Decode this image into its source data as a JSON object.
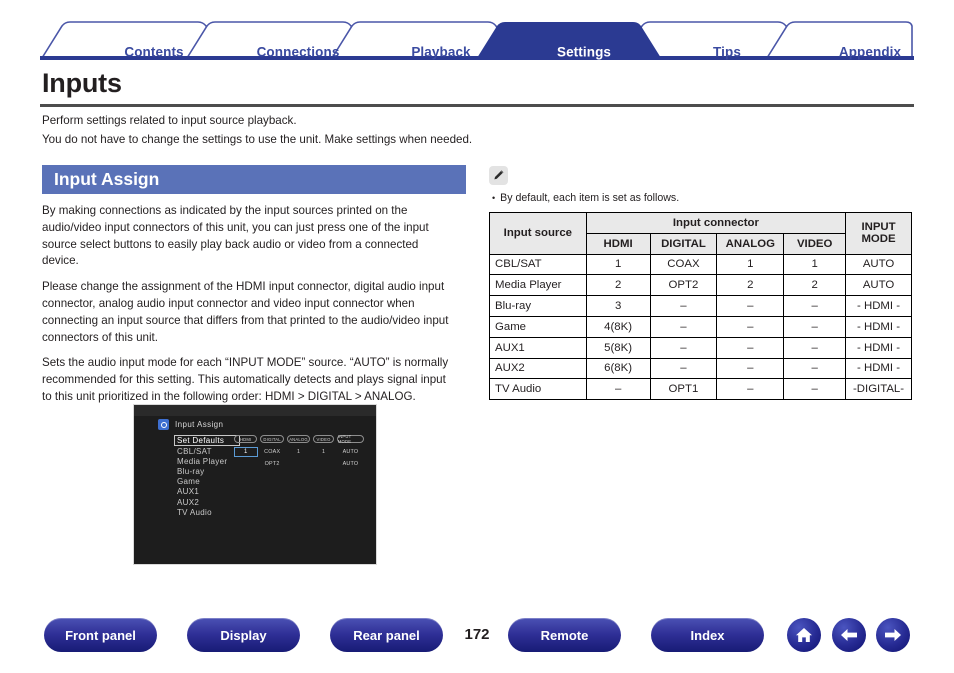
{
  "tabs": [
    {
      "label": "Contents",
      "active": false
    },
    {
      "label": "Connections",
      "active": false
    },
    {
      "label": "Playback",
      "active": false
    },
    {
      "label": "Settings",
      "active": true
    },
    {
      "label": "Tips",
      "active": false
    },
    {
      "label": "Appendix",
      "active": false
    }
  ],
  "page": {
    "title": "Inputs",
    "intro_line1": "Perform settings related to input source playback.",
    "intro_line2": "You do not have to change the settings to use the unit. Make settings when needed."
  },
  "section": {
    "header": "Input Assign",
    "paragraphs": [
      "By making connections as indicated by the input sources printed on the audio/video input connectors of this unit, you can just press one of the input source select buttons to easily play back audio or video from a connected device.",
      "Please change the assignment of the HDMI input connector, digital audio input connector, analog audio input connector and video input connector when connecting an input source that differs from that printed to the audio/video input connectors of this unit.",
      "Sets the audio input mode for each “INPUT MODE” source. “AUTO” is normally recommended for this setting. This automatically detects and plays signal input to this unit prioritized in the following order: HDMI > DIGITAL > ANALOG."
    ]
  },
  "osd": {
    "title": "Input Assign",
    "menu_items": [
      "Set Defaults",
      "CBL/SAT",
      "Media Player",
      "Blu-ray",
      "Game",
      "AUX1",
      "AUX2",
      "TV Audio"
    ],
    "selected_index": 0,
    "column_labels": [
      "HDMI",
      "DIGITAL",
      "ANALOG",
      "VIDEO",
      "INPUT MODE"
    ],
    "value_rows": [
      [
        "1",
        "COAX",
        "1",
        "1",
        "AUTO"
      ],
      [
        "",
        "OPT2",
        "",
        "",
        "AUTO"
      ]
    ]
  },
  "note": {
    "bullet": "•",
    "text": "By default, each item is set as follows."
  },
  "table": {
    "header_source": "Input source",
    "header_group": "Input connector",
    "header_mode_line1": "INPUT",
    "header_mode_line2": "MODE",
    "subheaders": [
      "HDMI",
      "DIGITAL",
      "ANALOG",
      "VIDEO"
    ],
    "rows": [
      {
        "source": "CBL/SAT",
        "hdmi": "1",
        "digital": "COAX",
        "analog": "1",
        "video": "1",
        "mode": "AUTO"
      },
      {
        "source": "Media Player",
        "hdmi": "2",
        "digital": "OPT2",
        "analog": "2",
        "video": "2",
        "mode": "AUTO"
      },
      {
        "source": "Blu-ray",
        "hdmi": "3",
        "digital": "–",
        "analog": "–",
        "video": "–",
        "mode": "- HDMI -"
      },
      {
        "source": "Game",
        "hdmi": "4(8K)",
        "digital": "–",
        "analog": "–",
        "video": "–",
        "mode": "- HDMI -"
      },
      {
        "source": "AUX1",
        "hdmi": "5(8K)",
        "digital": "–",
        "analog": "–",
        "video": "–",
        "mode": "- HDMI -"
      },
      {
        "source": "AUX2",
        "hdmi": "6(8K)",
        "digital": "–",
        "analog": "–",
        "video": "–",
        "mode": "- HDMI -"
      },
      {
        "source": "TV Audio",
        "hdmi": "–",
        "digital": "OPT1",
        "analog": "–",
        "video": "–",
        "mode": "-DIGITAL-"
      }
    ]
  },
  "footer": {
    "buttons": [
      "Front panel",
      "Display",
      "Rear panel",
      "Remote",
      "Index"
    ],
    "page_number": "172",
    "nav_icons": [
      "home-icon",
      "arrow-left-icon",
      "arrow-right-icon"
    ]
  },
  "colors": {
    "tab_active_bg": "#2b3a92",
    "tab_text": "#3a4aa0",
    "section_header_bg": "#5a72b8",
    "rule": "#4d4d4d",
    "table_header_bg": "#e9e9e9",
    "osd_bg": "#1d1d1d",
    "button_blue": "#2f2f96"
  }
}
